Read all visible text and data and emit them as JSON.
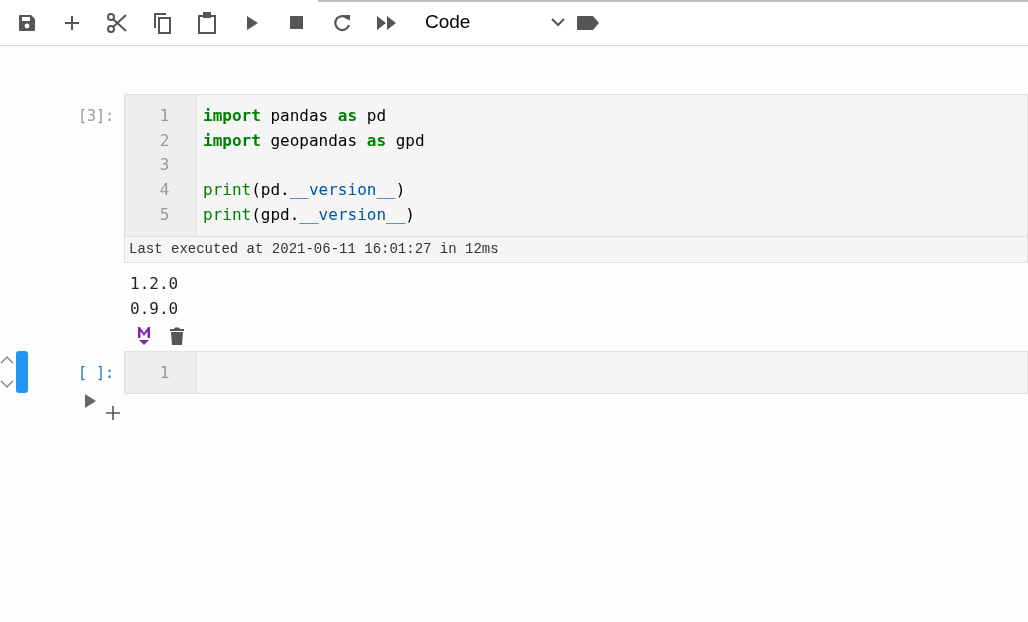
{
  "toolbar": {
    "buttons": [
      {
        "kind": "save"
      },
      {
        "kind": "add"
      },
      {
        "kind": "cut"
      },
      {
        "kind": "copy"
      },
      {
        "kind": "paste"
      },
      {
        "kind": "run"
      },
      {
        "kind": "stop"
      },
      {
        "kind": "restart"
      },
      {
        "kind": "run-all"
      }
    ],
    "cell_type": {
      "value": "Code"
    },
    "tag_button": {
      "kind": "tag"
    }
  },
  "cells": [
    {
      "prompt": "[3]:",
      "active": false,
      "lines": [
        {
          "number": "1",
          "tokens": [
            {
              "kind": "keyword",
              "text": "import"
            },
            {
              "kind": "plain",
              "text": " pandas "
            },
            {
              "kind": "keyword",
              "text": "as"
            },
            {
              "kind": "plain",
              "text": " pd"
            }
          ]
        },
        {
          "number": "2",
          "tokens": [
            {
              "kind": "keyword",
              "text": "import"
            },
            {
              "kind": "plain",
              "text": " geopandas "
            },
            {
              "kind": "keyword",
              "text": "as"
            },
            {
              "kind": "plain",
              "text": " gpd"
            }
          ]
        },
        {
          "number": "3"
        },
        {
          "number": "4",
          "tokens": [
            {
              "kind": "builtin",
              "text": "print"
            },
            {
              "kind": "plain",
              "text": "(pd."
            },
            {
              "kind": "attr",
              "text": "__version__"
            },
            {
              "kind": "plain",
              "text": ")"
            }
          ]
        },
        {
          "number": "5",
          "tokens": [
            {
              "kind": "builtin",
              "text": "print"
            },
            {
              "kind": "plain",
              "text": "(gpd."
            },
            {
              "kind": "attr",
              "text": "__version__"
            },
            {
              "kind": "plain",
              "text": ")"
            }
          ]
        }
      ],
      "execution_note": "Last executed at 2021-06-11 16:01:27 in 12ms",
      "outputs": [
        "1.2.0",
        "0.9.0"
      ],
      "actions": [
        {
          "kind": "markdown"
        },
        {
          "kind": "delete"
        }
      ]
    },
    {
      "prompt": "[ ]:",
      "active": true,
      "lines": [
        {
          "number": "1"
        }
      ]
    }
  ]
}
